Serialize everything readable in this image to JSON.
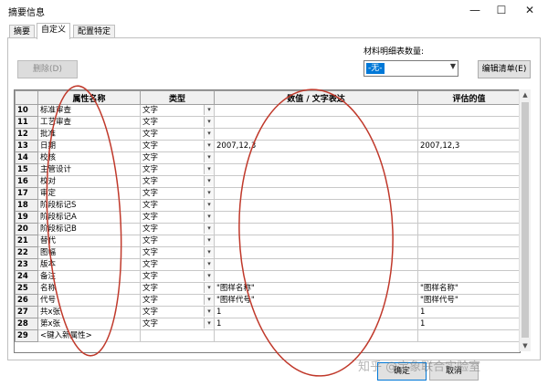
{
  "window": {
    "title": "摘要信息",
    "minimize": "—",
    "maximize": "☐",
    "close": "✕"
  },
  "tabs": [
    {
      "label": "摘要",
      "active": false
    },
    {
      "label": "自定义",
      "active": true
    },
    {
      "label": "配置特定",
      "active": false
    }
  ],
  "toolbar": {
    "delete_label": "删除(D)",
    "bom_qty_label": "材料明细表数量:",
    "bom_qty_value": "-无-",
    "edit_list_label": "编辑清单(E)"
  },
  "table": {
    "headers": [
      "",
      "属性名称",
      "类型",
      "数值 / 文字表达",
      "评估的值"
    ],
    "rows": [
      {
        "num": "10",
        "name": "标准审查",
        "type": "文字",
        "value": "",
        "evaluated": ""
      },
      {
        "num": "11",
        "name": "工艺审查",
        "type": "文字",
        "value": "",
        "evaluated": ""
      },
      {
        "num": "12",
        "name": "批准",
        "type": "文字",
        "value": "",
        "evaluated": ""
      },
      {
        "num": "13",
        "name": "日期",
        "type": "文字",
        "value": "2007,12,3",
        "evaluated": "2007,12,3"
      },
      {
        "num": "14",
        "name": "校核",
        "type": "文字",
        "value": "",
        "evaluated": ""
      },
      {
        "num": "15",
        "name": "主管设计",
        "type": "文字",
        "value": "",
        "evaluated": ""
      },
      {
        "num": "16",
        "name": "校对",
        "type": "文字",
        "value": "",
        "evaluated": ""
      },
      {
        "num": "17",
        "name": "审定",
        "type": "文字",
        "value": "",
        "evaluated": ""
      },
      {
        "num": "18",
        "name": "阶段标记S",
        "type": "文字",
        "value": "",
        "evaluated": ""
      },
      {
        "num": "19",
        "name": "阶段标记A",
        "type": "文字",
        "value": "",
        "evaluated": ""
      },
      {
        "num": "20",
        "name": "阶段标记B",
        "type": "文字",
        "value": "",
        "evaluated": ""
      },
      {
        "num": "21",
        "name": "替代",
        "type": "文字",
        "value": "",
        "evaluated": ""
      },
      {
        "num": "22",
        "name": "图幅",
        "type": "文字",
        "value": "",
        "evaluated": ""
      },
      {
        "num": "23",
        "name": "版本",
        "type": "文字",
        "value": "",
        "evaluated": ""
      },
      {
        "num": "24",
        "name": "备注",
        "type": "文字",
        "value": "",
        "evaluated": ""
      },
      {
        "num": "25",
        "name": "名称",
        "type": "文字",
        "value": "\"图样名称\"",
        "evaluated": "\"图样名称\""
      },
      {
        "num": "26",
        "name": "代号",
        "type": "文字",
        "value": "\"图样代号\"",
        "evaluated": "\"图样代号\""
      },
      {
        "num": "27",
        "name": "共x张",
        "type": "文字",
        "value": "1",
        "evaluated": "1"
      },
      {
        "num": "28",
        "name": "第x张",
        "type": "文字",
        "value": "1",
        "evaluated": "1"
      },
      {
        "num": "29",
        "name": "<键入新属性>",
        "type": "",
        "value": "",
        "evaluated": ""
      }
    ]
  },
  "footer": {
    "ok_label": "确定",
    "cancel_label": "取消"
  },
  "watermark": "知乎 @宝象联合实验室",
  "colors": {
    "selection": "#0078d7",
    "annotation": "#c0392b"
  }
}
